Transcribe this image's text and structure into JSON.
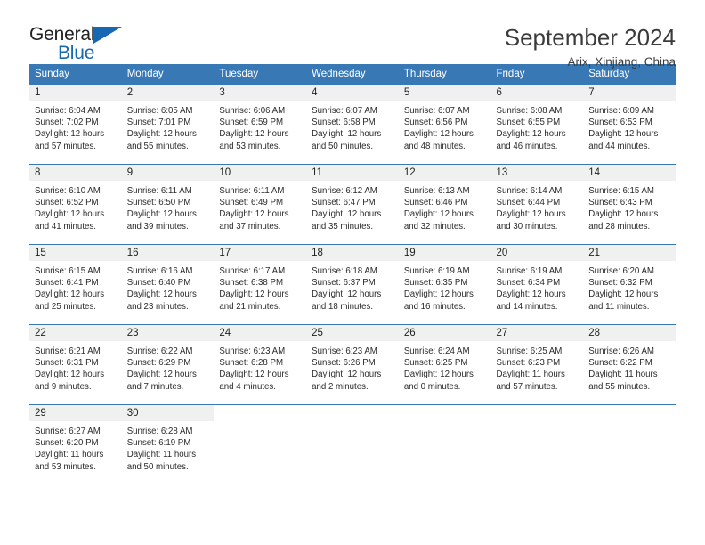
{
  "brand": {
    "name_part1": "General",
    "name_part2": "Blue",
    "accent_color": "#1668b3"
  },
  "header": {
    "title": "September 2024",
    "subtitle": "Arix, Xinjiang, China"
  },
  "theme": {
    "header_row_color": "#3878b5",
    "daynum_strip_color": "#f0f0f0",
    "text_color": "#2a2a2a"
  },
  "weekdays": [
    "Sunday",
    "Monday",
    "Tuesday",
    "Wednesday",
    "Thursday",
    "Friday",
    "Saturday"
  ],
  "weeks": [
    [
      {
        "day": "1",
        "sunrise": "Sunrise: 6:04 AM",
        "sunset": "Sunset: 7:02 PM",
        "daylight_line1": "Daylight: 12 hours",
        "daylight_line2": "and 57 minutes."
      },
      {
        "day": "2",
        "sunrise": "Sunrise: 6:05 AM",
        "sunset": "Sunset: 7:01 PM",
        "daylight_line1": "Daylight: 12 hours",
        "daylight_line2": "and 55 minutes."
      },
      {
        "day": "3",
        "sunrise": "Sunrise: 6:06 AM",
        "sunset": "Sunset: 6:59 PM",
        "daylight_line1": "Daylight: 12 hours",
        "daylight_line2": "and 53 minutes."
      },
      {
        "day": "4",
        "sunrise": "Sunrise: 6:07 AM",
        "sunset": "Sunset: 6:58 PM",
        "daylight_line1": "Daylight: 12 hours",
        "daylight_line2": "and 50 minutes."
      },
      {
        "day": "5",
        "sunrise": "Sunrise: 6:07 AM",
        "sunset": "Sunset: 6:56 PM",
        "daylight_line1": "Daylight: 12 hours",
        "daylight_line2": "and 48 minutes."
      },
      {
        "day": "6",
        "sunrise": "Sunrise: 6:08 AM",
        "sunset": "Sunset: 6:55 PM",
        "daylight_line1": "Daylight: 12 hours",
        "daylight_line2": "and 46 minutes."
      },
      {
        "day": "7",
        "sunrise": "Sunrise: 6:09 AM",
        "sunset": "Sunset: 6:53 PM",
        "daylight_line1": "Daylight: 12 hours",
        "daylight_line2": "and 44 minutes."
      }
    ],
    [
      {
        "day": "8",
        "sunrise": "Sunrise: 6:10 AM",
        "sunset": "Sunset: 6:52 PM",
        "daylight_line1": "Daylight: 12 hours",
        "daylight_line2": "and 41 minutes."
      },
      {
        "day": "9",
        "sunrise": "Sunrise: 6:11 AM",
        "sunset": "Sunset: 6:50 PM",
        "daylight_line1": "Daylight: 12 hours",
        "daylight_line2": "and 39 minutes."
      },
      {
        "day": "10",
        "sunrise": "Sunrise: 6:11 AM",
        "sunset": "Sunset: 6:49 PM",
        "daylight_line1": "Daylight: 12 hours",
        "daylight_line2": "and 37 minutes."
      },
      {
        "day": "11",
        "sunrise": "Sunrise: 6:12 AM",
        "sunset": "Sunset: 6:47 PM",
        "daylight_line1": "Daylight: 12 hours",
        "daylight_line2": "and 35 minutes."
      },
      {
        "day": "12",
        "sunrise": "Sunrise: 6:13 AM",
        "sunset": "Sunset: 6:46 PM",
        "daylight_line1": "Daylight: 12 hours",
        "daylight_line2": "and 32 minutes."
      },
      {
        "day": "13",
        "sunrise": "Sunrise: 6:14 AM",
        "sunset": "Sunset: 6:44 PM",
        "daylight_line1": "Daylight: 12 hours",
        "daylight_line2": "and 30 minutes."
      },
      {
        "day": "14",
        "sunrise": "Sunrise: 6:15 AM",
        "sunset": "Sunset: 6:43 PM",
        "daylight_line1": "Daylight: 12 hours",
        "daylight_line2": "and 28 minutes."
      }
    ],
    [
      {
        "day": "15",
        "sunrise": "Sunrise: 6:15 AM",
        "sunset": "Sunset: 6:41 PM",
        "daylight_line1": "Daylight: 12 hours",
        "daylight_line2": "and 25 minutes."
      },
      {
        "day": "16",
        "sunrise": "Sunrise: 6:16 AM",
        "sunset": "Sunset: 6:40 PM",
        "daylight_line1": "Daylight: 12 hours",
        "daylight_line2": "and 23 minutes."
      },
      {
        "day": "17",
        "sunrise": "Sunrise: 6:17 AM",
        "sunset": "Sunset: 6:38 PM",
        "daylight_line1": "Daylight: 12 hours",
        "daylight_line2": "and 21 minutes."
      },
      {
        "day": "18",
        "sunrise": "Sunrise: 6:18 AM",
        "sunset": "Sunset: 6:37 PM",
        "daylight_line1": "Daylight: 12 hours",
        "daylight_line2": "and 18 minutes."
      },
      {
        "day": "19",
        "sunrise": "Sunrise: 6:19 AM",
        "sunset": "Sunset: 6:35 PM",
        "daylight_line1": "Daylight: 12 hours",
        "daylight_line2": "and 16 minutes."
      },
      {
        "day": "20",
        "sunrise": "Sunrise: 6:19 AM",
        "sunset": "Sunset: 6:34 PM",
        "daylight_line1": "Daylight: 12 hours",
        "daylight_line2": "and 14 minutes."
      },
      {
        "day": "21",
        "sunrise": "Sunrise: 6:20 AM",
        "sunset": "Sunset: 6:32 PM",
        "daylight_line1": "Daylight: 12 hours",
        "daylight_line2": "and 11 minutes."
      }
    ],
    [
      {
        "day": "22",
        "sunrise": "Sunrise: 6:21 AM",
        "sunset": "Sunset: 6:31 PM",
        "daylight_line1": "Daylight: 12 hours",
        "daylight_line2": "and 9 minutes."
      },
      {
        "day": "23",
        "sunrise": "Sunrise: 6:22 AM",
        "sunset": "Sunset: 6:29 PM",
        "daylight_line1": "Daylight: 12 hours",
        "daylight_line2": "and 7 minutes."
      },
      {
        "day": "24",
        "sunrise": "Sunrise: 6:23 AM",
        "sunset": "Sunset: 6:28 PM",
        "daylight_line1": "Daylight: 12 hours",
        "daylight_line2": "and 4 minutes."
      },
      {
        "day": "25",
        "sunrise": "Sunrise: 6:23 AM",
        "sunset": "Sunset: 6:26 PM",
        "daylight_line1": "Daylight: 12 hours",
        "daylight_line2": "and 2 minutes."
      },
      {
        "day": "26",
        "sunrise": "Sunrise: 6:24 AM",
        "sunset": "Sunset: 6:25 PM",
        "daylight_line1": "Daylight: 12 hours",
        "daylight_line2": "and 0 minutes."
      },
      {
        "day": "27",
        "sunrise": "Sunrise: 6:25 AM",
        "sunset": "Sunset: 6:23 PM",
        "daylight_line1": "Daylight: 11 hours",
        "daylight_line2": "and 57 minutes."
      },
      {
        "day": "28",
        "sunrise": "Sunrise: 6:26 AM",
        "sunset": "Sunset: 6:22 PM",
        "daylight_line1": "Daylight: 11 hours",
        "daylight_line2": "and 55 minutes."
      }
    ],
    [
      {
        "day": "29",
        "sunrise": "Sunrise: 6:27 AM",
        "sunset": "Sunset: 6:20 PM",
        "daylight_line1": "Daylight: 11 hours",
        "daylight_line2": "and 53 minutes."
      },
      {
        "day": "30",
        "sunrise": "Sunrise: 6:28 AM",
        "sunset": "Sunset: 6:19 PM",
        "daylight_line1": "Daylight: 11 hours",
        "daylight_line2": "and 50 minutes."
      },
      {
        "day": "",
        "sunrise": "",
        "sunset": "",
        "daylight_line1": "",
        "daylight_line2": ""
      },
      {
        "day": "",
        "sunrise": "",
        "sunset": "",
        "daylight_line1": "",
        "daylight_line2": ""
      },
      {
        "day": "",
        "sunrise": "",
        "sunset": "",
        "daylight_line1": "",
        "daylight_line2": ""
      },
      {
        "day": "",
        "sunrise": "",
        "sunset": "",
        "daylight_line1": "",
        "daylight_line2": ""
      },
      {
        "day": "",
        "sunrise": "",
        "sunset": "",
        "daylight_line1": "",
        "daylight_line2": ""
      }
    ]
  ]
}
